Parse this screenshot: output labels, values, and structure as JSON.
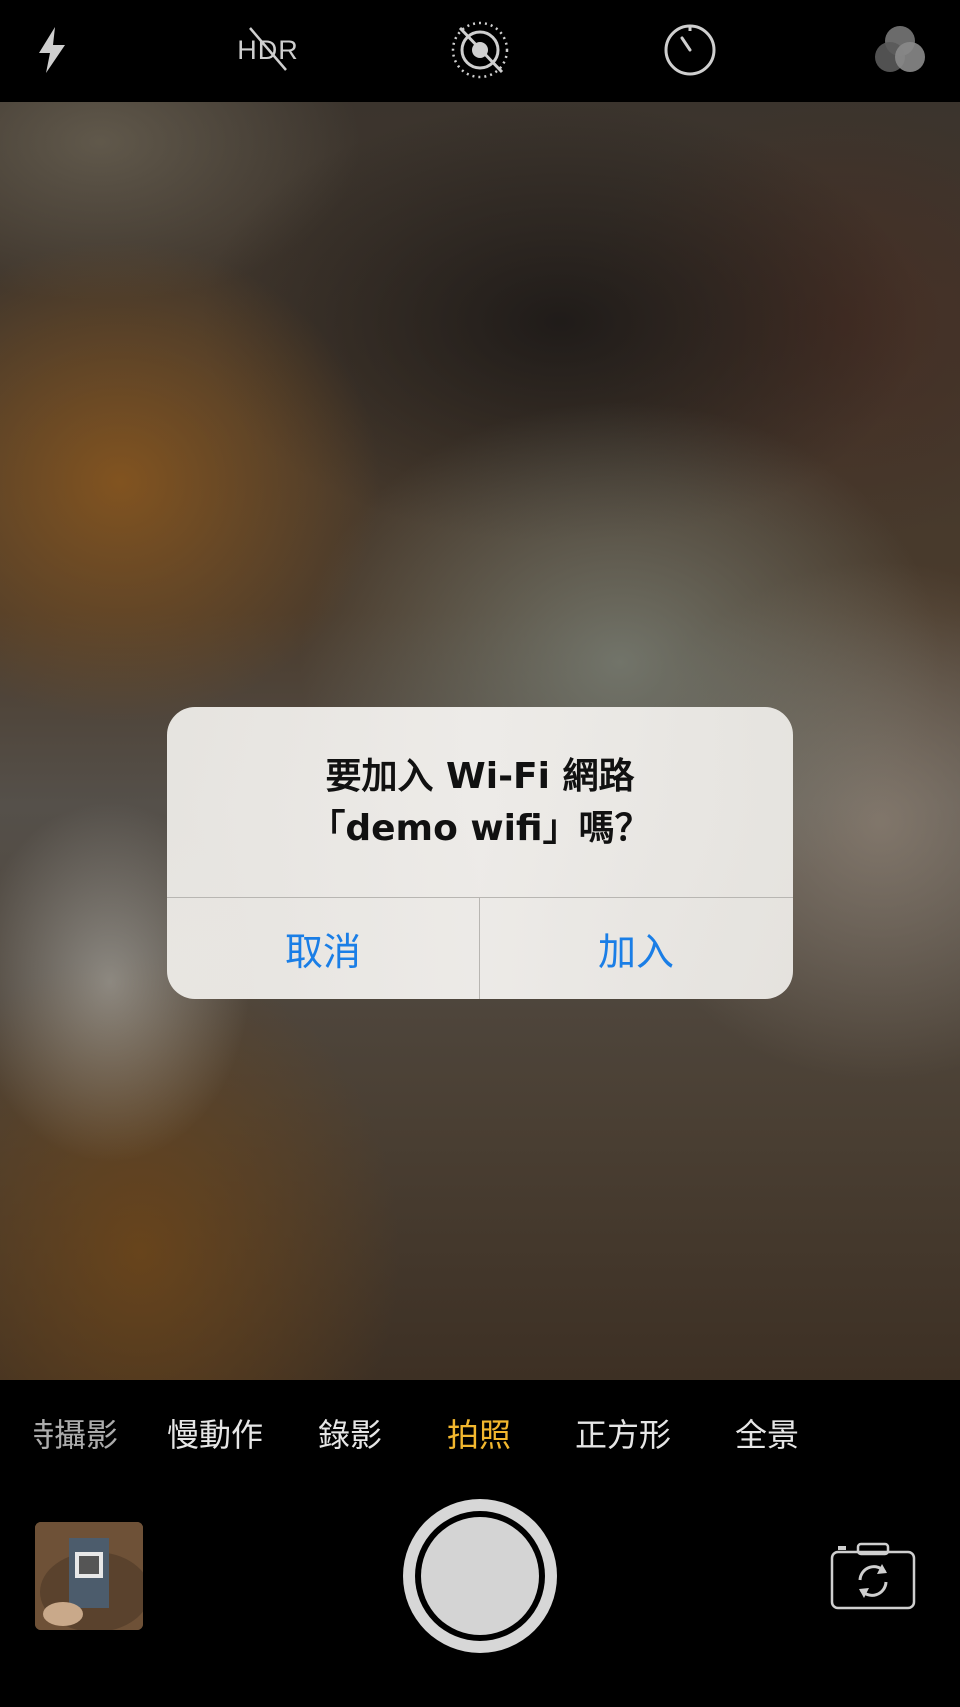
{
  "topbar": {
    "icons": [
      "flash-icon",
      "hdr-off-icon",
      "live-photo-off-icon",
      "timer-icon",
      "filters-icon"
    ],
    "hdr_label": "HDR"
  },
  "alert": {
    "title": "要加入 Wi-Fi 網路\n「demo wifi」嗎？",
    "cancel_label": "取消",
    "join_label": "加入"
  },
  "modes": {
    "items": [
      "縮時攝影",
      "慢動作",
      "錄影",
      "拍照",
      "正方形",
      "全景"
    ],
    "active": "拍照"
  },
  "colors": {
    "accent_blue": "#1a7ee6",
    "active_mode": "#f2b72e"
  },
  "controls": {
    "icons": [
      "last-photo-thumbnail",
      "shutter-button",
      "switch-camera-icon"
    ]
  }
}
